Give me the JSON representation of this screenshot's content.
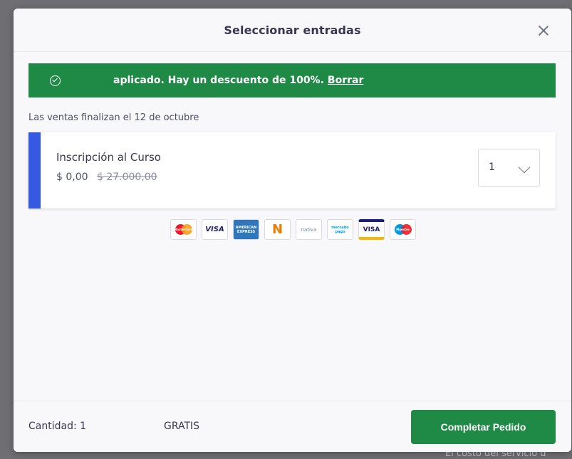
{
  "modal": {
    "title": "Seleccionar entradas"
  },
  "banner": {
    "text": "aplicado. Hay un descuento de 100%.",
    "link": "Borrar"
  },
  "sales_end": "Las ventas finalizan el 12 de octubre",
  "ticket": {
    "name": "Inscripción al Curso",
    "price": "$ 0,00",
    "old_price": "$ 27.000,00",
    "quantity": "1"
  },
  "payment_methods": [
    {
      "icon": "mastercard-icon",
      "label": "MasterCard"
    },
    {
      "icon": "visa-icon",
      "label": "VISA"
    },
    {
      "icon": "amex-icon",
      "label": "AMERICAN EXPRESS"
    },
    {
      "icon": "naranja-icon",
      "label": "N"
    },
    {
      "icon": "nativa-icon",
      "label": "nativa"
    },
    {
      "icon": "mercadopago-icon",
      "label": "mercado pago"
    },
    {
      "icon": "visa-debit-icon",
      "label": "VISA"
    },
    {
      "icon": "maestro-icon",
      "label": "Maestro"
    }
  ],
  "footer": {
    "quantity": "Cantidad: 1",
    "total": "GRATIS",
    "button": "Completar Pedido"
  },
  "background": {
    "bottom_text": "El costo del servicio d"
  },
  "colors": {
    "primary_green": "#1e8a45",
    "ticket_accent": "#3659e3"
  }
}
